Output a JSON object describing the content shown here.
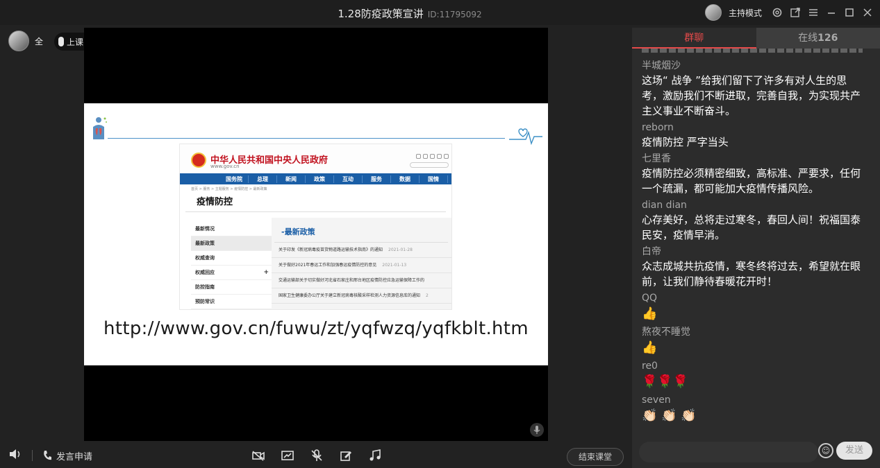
{
  "window": {
    "title": "1.28防疫政策宣讲",
    "room_id": "ID:11795092",
    "mode_label": "主持模式"
  },
  "stage": {
    "all_label": "全",
    "status_label": "上课中"
  },
  "slide": {
    "site_name": "中华人民共和国中央人民政府",
    "site_url": "www.gov.cn",
    "nav": [
      "国务院",
      "总理",
      "新闻",
      "政策",
      "互动",
      "服务",
      "数据",
      "国情"
    ],
    "breadcrumb": "首页 > 服务 > 主题服务 > 疫情防控 > 最新政策",
    "page_heading": "疫情防控",
    "side_menu": [
      "最新情况",
      "最新政策",
      "权威查询",
      "权威回应",
      "防控指南",
      "预防常识"
    ],
    "content_title": "-最新政策",
    "policies": [
      {
        "text": "关于印发《新冠病毒疫苗货物道路运输技术指南》的通知",
        "date": "2021-01-28"
      },
      {
        "text": "关于做好2021年春运工作和加强春运疫情防控的意见",
        "date": "2021-01-13"
      },
      {
        "text": "交通运输部关于切实做好河北省石家庄和邢台地区疫情防控应急运输保障工作的",
        "date": ""
      },
      {
        "text": "国家卫生健康委办公厅关于建立新冠病毒核酸采样检测人力资源信息库的通知",
        "date": "2"
      }
    ],
    "url_text": "http://www.gov.cn/fuwu/zt/yqfwzq/yqfkblt.htm"
  },
  "bottombar": {
    "speak_request": "发言申请",
    "end_class": "结束课堂"
  },
  "panel": {
    "tab_chat": "群聊",
    "tab_online": "在线",
    "online_count": "126",
    "send_label": "发送"
  },
  "messages": [
    {
      "name": "半城烟沙",
      "text": "这场“ 战争 ”给我们留下了许多有对人生的思考，激励我们不断进取，完善自我，为实现共产主义事业不断奋斗。"
    },
    {
      "name": "reborn",
      "text": "疫情防控  严字当头"
    },
    {
      "name": "七里香",
      "text": "疫情防控必须精密细致，高标准、严要求，任何一个疏漏，都可能加大疫情传播风险。"
    },
    {
      "name": "dian dian",
      "text": "心存美好，总将走过寒冬，春回人间！祝福国泰民安，疫情早消。"
    },
    {
      "name": "白帝",
      "text": "众志成城共抗疫情，寒冬终将过去，希望就在眼前，让我们静待春暖花开时！"
    },
    {
      "name": "QQ",
      "text": "👍"
    },
    {
      "name": "熬夜不睡觉",
      "text": "👍"
    },
    {
      "name": "re0",
      "text": "🌹🌹🌹"
    },
    {
      "name": "seven",
      "text": "👏🏻 👏🏻 👏🏻"
    }
  ],
  "icons": {
    "settings": "gear-icon",
    "popout": "external-window-icon",
    "menu": "hamburger-icon",
    "minimize": "minimize-icon",
    "maximize": "maximize-icon",
    "close": "close-icon"
  },
  "colors": {
    "accent_red": "#e64a4a",
    "gov_blue": "#1a5ea6",
    "gov_red": "#c1121f"
  }
}
